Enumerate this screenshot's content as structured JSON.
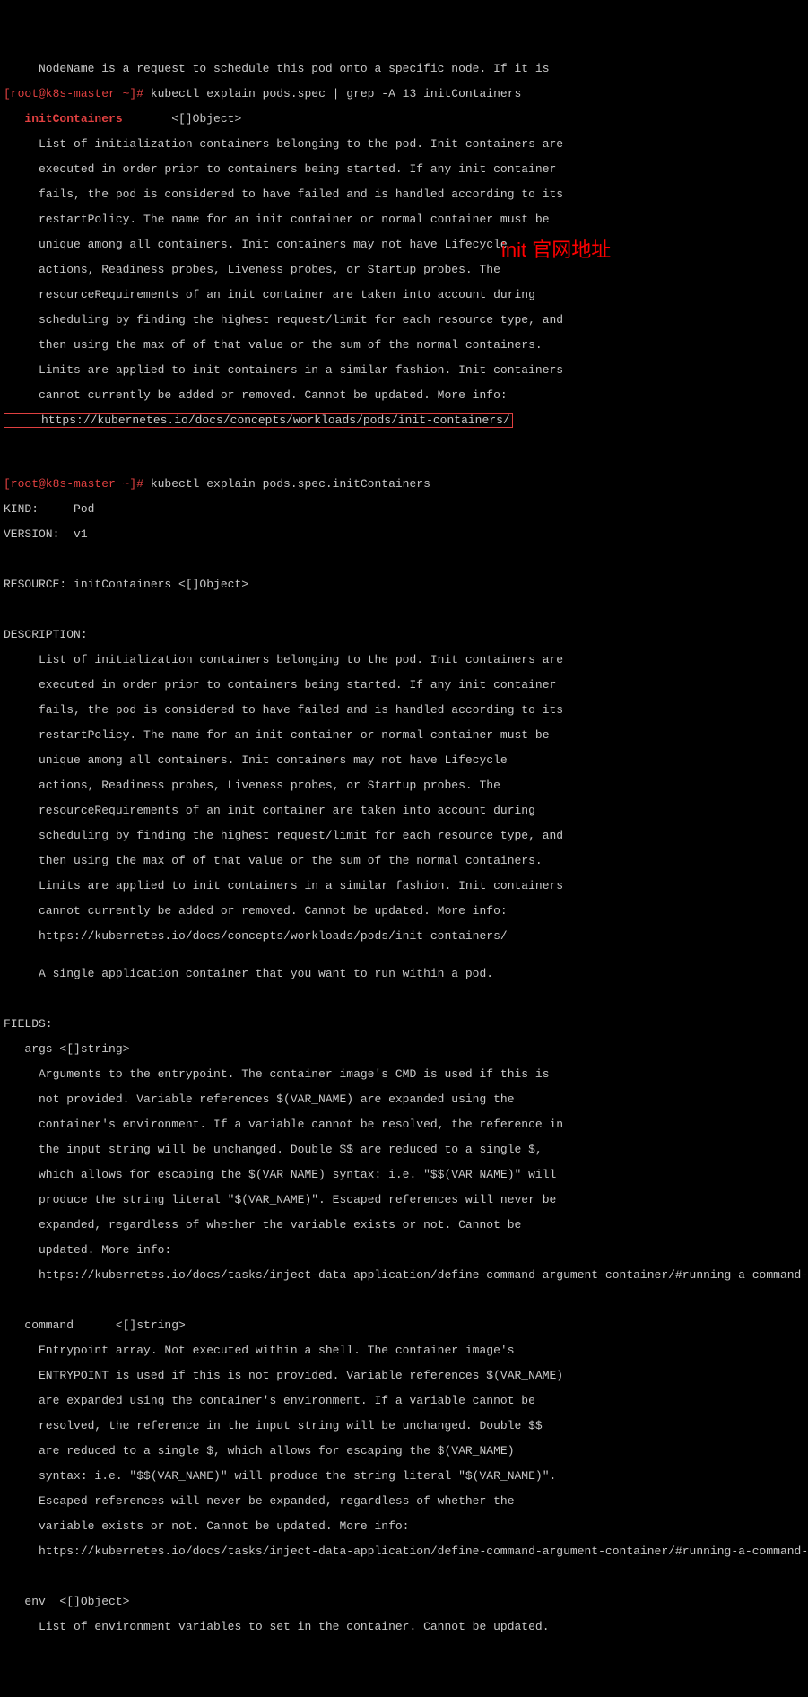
{
  "line0": "     NodeName is a request to schedule this pod onto a specific node. If it is",
  "prompt1": "[root@k8s-master ~]#",
  "cmd1": " kubectl explain pods.spec | grep -A 13 initContainers",
  "field_bold": "   initContainers",
  "field_type": "       <[]Object>",
  "desc1": [
    "     List of initialization containers belonging to the pod. Init containers are",
    "     executed in order prior to containers being started. If any init container",
    "     fails, the pod is considered to have failed and is handled according to its",
    "     restartPolicy. The name for an init container or normal container must be",
    "     unique among all containers. Init containers may not have Lifecycle",
    "     actions, Readiness probes, Liveness probes, or Startup probes. The",
    "     resourceRequirements of an init container are taken into account during",
    "     scheduling by finding the highest request/limit for each resource type, and",
    "     then using the max of of that value or the sum of the normal containers.",
    "     Limits are applied to init containers in a similar fashion. Init containers",
    "     cannot currently be added or removed. Cannot be updated. More info:"
  ],
  "boxed_url": "     https://kubernetes.io/docs/concepts/workloads/pods/init-containers/",
  "annotation_text": "init 官网地址",
  "prompt2": "[root@k8s-master ~]#",
  "cmd2": " kubectl explain pods.spec.initContainers",
  "kind": "KIND:     Pod",
  "version": "VERSION:  v1",
  "resource": "RESOURCE: initContainers <[]Object>",
  "desc_hdr": "DESCRIPTION:",
  "desc2": [
    "     List of initialization containers belonging to the pod. Init containers are",
    "     executed in order prior to containers being started. If any init container",
    "     fails, the pod is considered to have failed and is handled according to its",
    "     restartPolicy. The name for an init container or normal container must be",
    "     unique among all containers. Init containers may not have Lifecycle",
    "     actions, Readiness probes, Liveness probes, or Startup probes. The",
    "     resourceRequirements of an init container are taken into account during",
    "     scheduling by finding the highest request/limit for each resource type, and",
    "     then using the max of of that value or the sum of the normal containers.",
    "     Limits are applied to init containers in a similar fashion. Init containers",
    "     cannot currently be added or removed. Cannot be updated. More info:",
    "     https://kubernetes.io/docs/concepts/workloads/pods/init-containers/",
    "",
    "     A single application container that you want to run within a pod."
  ],
  "fields_hdr": "FIELDS:",
  "args_hdr": "   args <[]string>",
  "args_desc": [
    "     Arguments to the entrypoint. The container image's CMD is used if this is",
    "     not provided. Variable references $(VAR_NAME) are expanded using the",
    "     container's environment. If a variable cannot be resolved, the reference in",
    "     the input string will be unchanged. Double $$ are reduced to a single $,",
    "     which allows for escaping the $(VAR_NAME) syntax: i.e. \"$$(VAR_NAME)\" will",
    "     produce the string literal \"$(VAR_NAME)\". Escaped references will never be",
    "     expanded, regardless of whether the variable exists or not. Cannot be",
    "     updated. More info:",
    "     https://kubernetes.io/docs/tasks/inject-data-application/define-command-argument-container/#running-a-command-in-a-shell"
  ],
  "command_hdr": "   command      <[]string>",
  "command_desc": [
    "     Entrypoint array. Not executed within a shell. The container image's",
    "     ENTRYPOINT is used if this is not provided. Variable references $(VAR_NAME)",
    "     are expanded using the container's environment. If a variable cannot be",
    "     resolved, the reference in the input string will be unchanged. Double $$",
    "     are reduced to a single $, which allows for escaping the $(VAR_NAME)",
    "     syntax: i.e. \"$$(VAR_NAME)\" will produce the string literal \"$(VAR_NAME)\".",
    "     Escaped references will never be expanded, regardless of whether the",
    "     variable exists or not. Cannot be updated. More info:",
    "     https://kubernetes.io/docs/tasks/inject-data-application/define-command-argument-container/#running-a-command-in-a-shell"
  ],
  "env_hdr": "   env  <[]Object>",
  "env_desc": "     List of environment variables to set in the container. Cannot be updated."
}
